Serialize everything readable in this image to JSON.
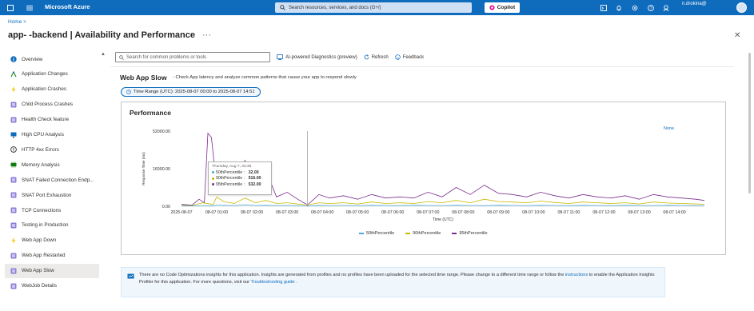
{
  "topbar": {
    "brand": "Microsoft Azure",
    "search_placeholder": "Search resources, services, and docs (G+/)",
    "copilot_label": "Copilot",
    "user_name": "n.drokina@",
    "user_org": "",
    "bg_color": "#0f6cbd",
    "icons": [
      "portal-menu-icon",
      "hamburger-icon",
      "cloud-shell-icon",
      "notifications-icon",
      "settings-icon",
      "help-icon",
      "feedback-icon"
    ]
  },
  "header": {
    "breadcrumb": "Home >",
    "title": "app-              -backend | Availability and Performance",
    "more_label": "···"
  },
  "sidebar": {
    "items": [
      {
        "label": "Overview",
        "icon": "info-icon",
        "active": false
      },
      {
        "label": "Application Changes",
        "icon": "changes-icon",
        "active": false
      },
      {
        "label": "Application Crashes",
        "icon": "lightning-icon",
        "active": false
      },
      {
        "label": "Child Process Crashes",
        "icon": "diagnostic-icon",
        "active": false
      },
      {
        "label": "Health Check feature",
        "icon": "diagnostic-icon",
        "active": false
      },
      {
        "label": "High CPU Analysis",
        "icon": "monitor-icon",
        "active": false
      },
      {
        "label": "HTTP 4xx Errors",
        "icon": "error-icon",
        "active": false
      },
      {
        "label": "Memory Analysis",
        "icon": "memory-icon",
        "active": false
      },
      {
        "label": "SNAT Failed Connection Endp...",
        "icon": "diagnostic-icon",
        "active": false
      },
      {
        "label": "SNAT Port Exhaustion",
        "icon": "diagnostic-icon",
        "active": false
      },
      {
        "label": "TCP Connections",
        "icon": "diagnostic-icon",
        "active": false
      },
      {
        "label": "Testing in Production",
        "icon": "diagnostic-icon",
        "active": false
      },
      {
        "label": "Web App Down",
        "icon": "lightning-icon",
        "active": false
      },
      {
        "label": "Web App Restarted",
        "icon": "diagnostic-icon",
        "active": false
      },
      {
        "label": "Web App Slow",
        "icon": "diagnostic-icon",
        "active": true
      },
      {
        "label": "WebJob Details",
        "icon": "diagnostic-icon",
        "active": false
      }
    ]
  },
  "toolbar": {
    "search_placeholder": "Search for common problems or tools",
    "ai_label": "AI-powered Diagnostics (preview)",
    "refresh_label": "Refresh",
    "feedback_label": "Feedback"
  },
  "detector": {
    "title": "Web App Slow",
    "description": "- Check App latency and analyze common patterns that cause your app to respond slowly",
    "time_range": "Time Range (UTC): 2025-08-07 00:00 to 2025-08-07 14:51"
  },
  "performance": {
    "title": "Performance",
    "none_label": "None",
    "tooltip": {
      "header": "Thursday, Aug 7, 03:35",
      "rows": [
        {
          "name": "50thPercentile",
          "value": "32.00",
          "color": "#4aa8d8"
        },
        {
          "name": "90thPercentile",
          "value": "516.00",
          "color": "#c5b800"
        },
        {
          "name": "95thPercentile",
          "value": "532.00",
          "color": "#7b2d8e"
        }
      ]
    }
  },
  "chart_data": {
    "type": "line",
    "ylabel": "Response Time (ms)",
    "xlabel": "Time (UTC)",
    "ylim": [
      0,
      52000
    ],
    "yticks": [
      "52000.00",
      "16000.00",
      "0.00"
    ],
    "ytick_values": [
      52000,
      16000,
      0
    ],
    "xticks": [
      "2025-08-07",
      "08-07 01:00",
      "08-07 02:00",
      "08-07 03:00",
      "08-07 04:00",
      "08-07 05:00",
      "08-07 06:00",
      "08-07 07:00",
      "08-07 08:00",
      "08-07 09:00",
      "08-07 10:00",
      "08-07 11:00",
      "08-07 12:00",
      "08-07 13:00",
      "08-07 14:00"
    ],
    "xlim_hours": [
      0,
      14.85
    ],
    "cursor_hour": 3.58,
    "legend_position": "bottom",
    "series": [
      {
        "name": "50thPercentile",
        "color": "#4aa8d8",
        "x": [
          0,
          0.3,
          0.6,
          0.9,
          1.0,
          1.2,
          1.5,
          1.8,
          2.1,
          2.4,
          2.7,
          3.0,
          3.3,
          3.58,
          3.9,
          4.2,
          4.6,
          5.0,
          5.4,
          5.8,
          6.2,
          6.6,
          7.0,
          7.4,
          7.8,
          8.2,
          8.6,
          9.0,
          9.4,
          9.8,
          10.2,
          10.6,
          11.0,
          11.4,
          11.8,
          12.2,
          12.6,
          13.0,
          13.4,
          13.8,
          14.2,
          14.6,
          14.85
        ],
        "y": [
          200,
          150,
          300,
          250,
          500,
          400,
          300,
          600,
          350,
          400,
          300,
          350,
          300,
          32,
          400,
          300,
          350,
          300,
          400,
          350,
          300,
          400,
          350,
          300,
          400,
          350,
          300,
          400,
          350,
          300,
          400,
          350,
          300,
          400,
          350,
          300,
          400,
          350,
          300,
          400,
          350,
          300,
          300
        ]
      },
      {
        "name": "90thPercentile",
        "color": "#c5b800",
        "x": [
          0,
          0.3,
          0.6,
          0.9,
          1.0,
          1.2,
          1.5,
          1.8,
          2.1,
          2.4,
          2.7,
          3.0,
          3.3,
          3.58,
          3.9,
          4.2,
          4.6,
          5.0,
          5.4,
          5.8,
          6.2,
          6.6,
          7.0,
          7.4,
          7.8,
          8.2,
          8.6,
          9.0,
          9.4,
          9.8,
          10.2,
          10.6,
          11.0,
          11.4,
          11.8,
          12.2,
          12.6,
          13.0,
          13.4,
          13.8,
          14.2,
          14.6,
          14.85
        ],
        "y": [
          400,
          300,
          1500,
          800,
          4000,
          2000,
          1200,
          3500,
          1500,
          2500,
          1200,
          1500,
          1000,
          516,
          1500,
          1200,
          1500,
          1000,
          1800,
          1200,
          1500,
          1200,
          2000,
          1500,
          2500,
          1500,
          3000,
          2000,
          1800,
          1500,
          2200,
          1600,
          1200,
          1800,
          1500,
          1200,
          1500,
          1000,
          1800,
          1400,
          1200,
          1000,
          900
        ]
      },
      {
        "name": "95thPercentile",
        "color": "#7b2d8e",
        "x": [
          0,
          0.3,
          0.5,
          0.65,
          0.75,
          0.85,
          1.0,
          1.2,
          1.5,
          1.8,
          2.1,
          2.4,
          2.7,
          3.0,
          3.3,
          3.58,
          3.9,
          4.2,
          4.6,
          5.0,
          5.4,
          5.8,
          6.2,
          6.6,
          7.0,
          7.4,
          7.8,
          8.2,
          8.6,
          9.0,
          9.4,
          9.8,
          10.2,
          10.6,
          11.0,
          11.4,
          11.8,
          12.2,
          12.6,
          13.0,
          13.4,
          13.8,
          14.2,
          14.6,
          14.85
        ],
        "y": [
          800,
          500,
          3000,
          1500,
          50000,
          46000,
          8000,
          22000,
          5000,
          24000,
          8000,
          15000,
          4000,
          6000,
          3000,
          532,
          5000,
          3500,
          4500,
          3000,
          5000,
          3500,
          4000,
          3500,
          6000,
          4000,
          8000,
          5000,
          9000,
          5500,
          5000,
          4000,
          6000,
          4500,
          3500,
          5000,
          4000,
          3500,
          4500,
          3000,
          5000,
          4000,
          3500,
          3000,
          2500
        ]
      }
    ]
  },
  "legend": [
    "50thPercentile",
    "90thPercentile",
    "95thPercentile"
  ],
  "info": {
    "text1": "There are no Code Optimizations insights for this application. Insights are generated from profiles and no profiles have been uploaded for the selected time range. Please change to a different time range or follow the",
    "link1": "instructions",
    "text2": "to enable the Application Insights Profiler for this application. For more questions, visit our",
    "link2": "Troubleshooting guide",
    "text3": "."
  }
}
